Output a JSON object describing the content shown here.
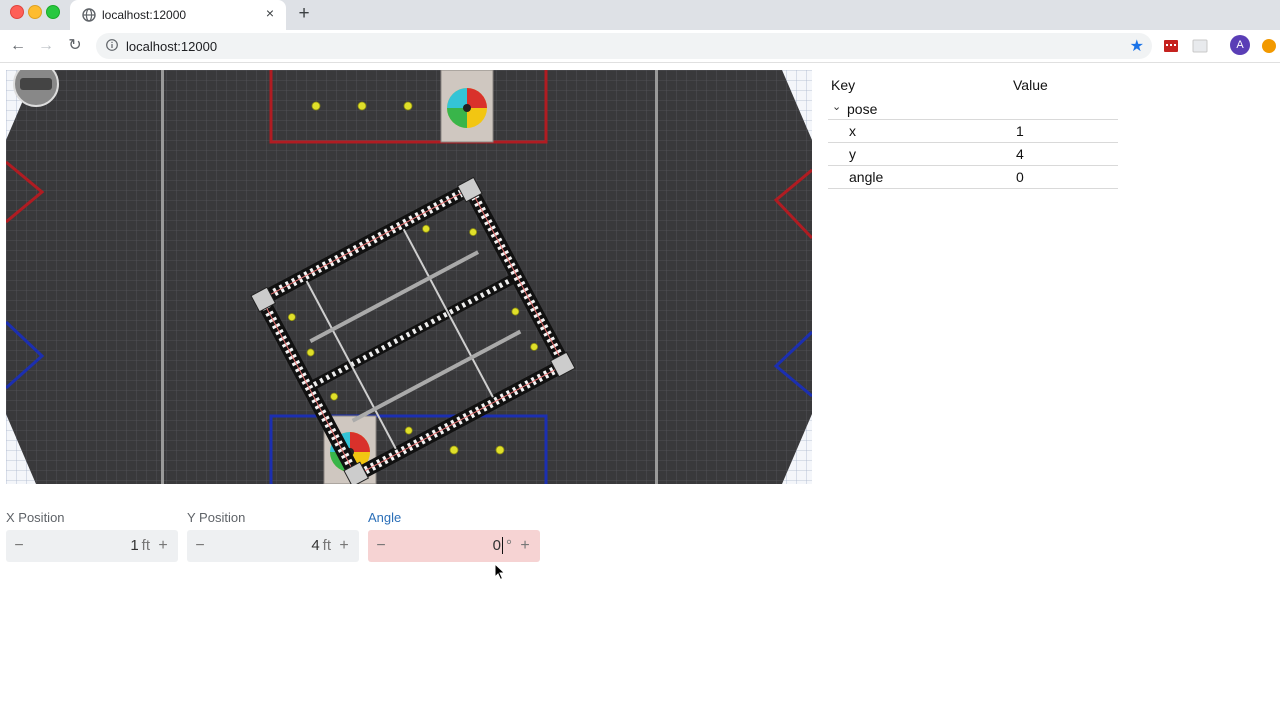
{
  "browser": {
    "tab_title": "localhost:12000",
    "url": "localhost:12000",
    "avatar_letter": "A",
    "tab_close_glyph": "×",
    "new_tab_glyph": "+",
    "back_glyph": "←",
    "forward_glyph": "→",
    "reload_glyph": "↻",
    "star_glyph": "★"
  },
  "table": {
    "header_key": "Key",
    "header_value": "Value",
    "group": {
      "label": "pose",
      "chevron": "⌄"
    },
    "rows": [
      {
        "key": "x",
        "value": "1"
      },
      {
        "key": "y",
        "value": "4"
      },
      {
        "key": "angle",
        "value": "0"
      }
    ]
  },
  "controls": {
    "x": {
      "label": "X Position",
      "value": "1",
      "unit": "ft",
      "minus": "−",
      "plus": "+"
    },
    "y": {
      "label": "Y Position",
      "value": "4",
      "unit": "ft",
      "minus": "−",
      "plus": "+"
    },
    "angle": {
      "label": "Angle",
      "value": "0",
      "unit": "°",
      "minus": "−",
      "plus": "+"
    }
  },
  "colors": {
    "field_carpet": "#3a3a3c",
    "red_alliance": "#b01c22",
    "blue_alliance": "#1c2fb0",
    "cargo": "#e0e02a",
    "active_input_bg": "#f6d3d3",
    "active_label": "#2b6fb8"
  }
}
